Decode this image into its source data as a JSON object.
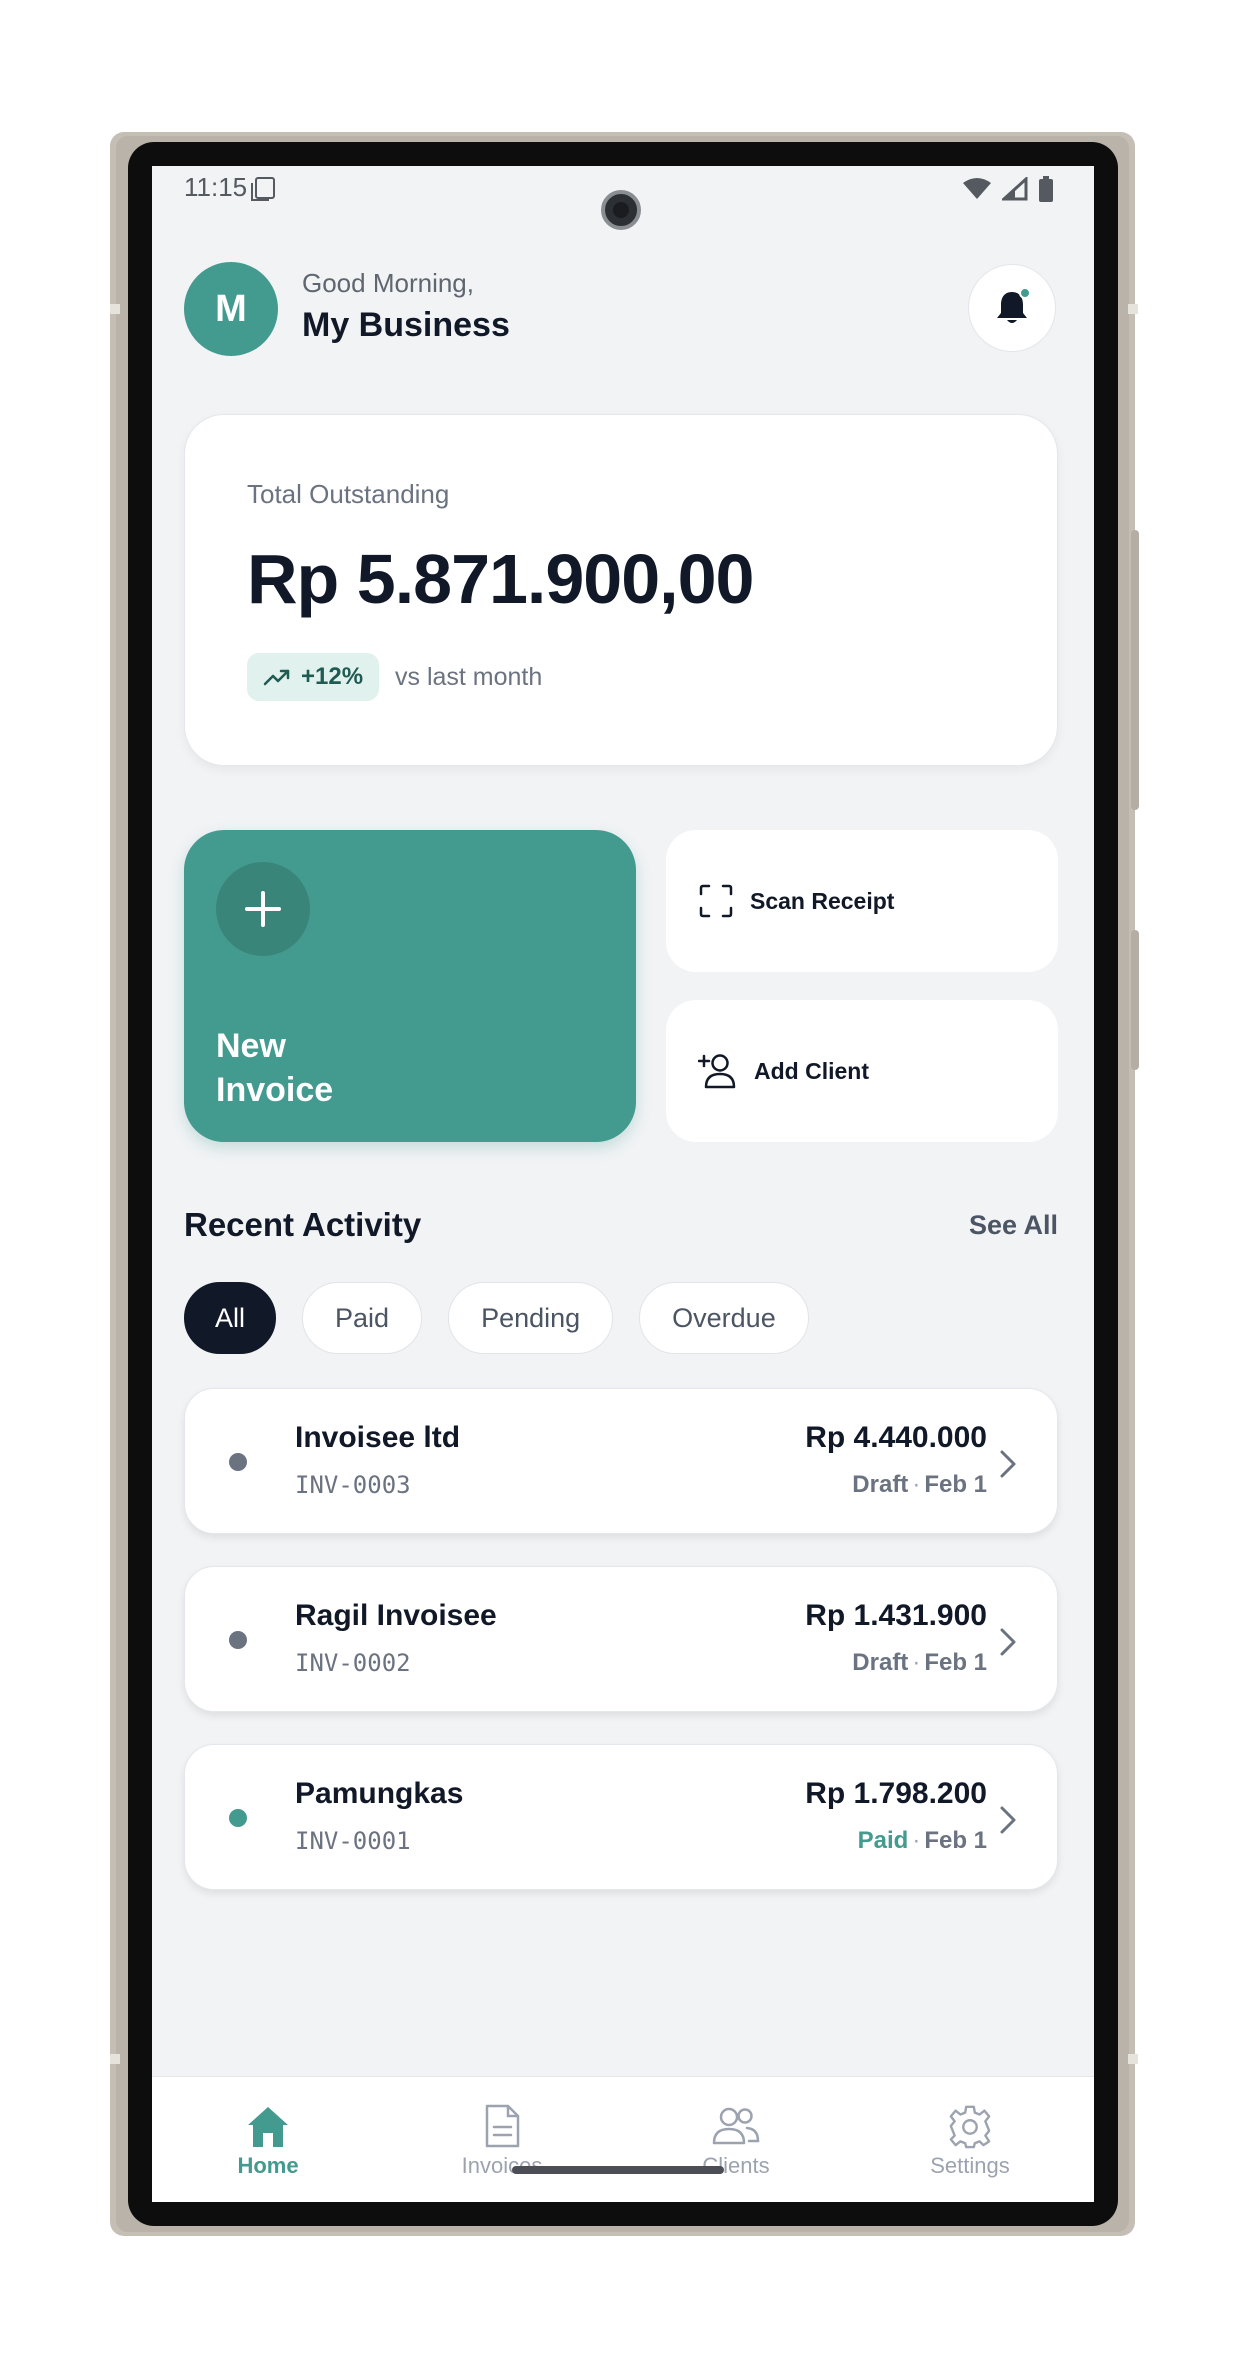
{
  "status_bar": {
    "time": "11:15"
  },
  "header": {
    "avatar_initial": "M",
    "greeting": "Good Morning,",
    "business_name": "My Business"
  },
  "summary": {
    "label": "Total Outstanding",
    "amount": "Rp 5.871.900,00",
    "trend": "+12%",
    "trend_caption": "vs last month"
  },
  "actions": {
    "new_invoice_line1": "New",
    "new_invoice_line2": "Invoice",
    "scan_receipt": "Scan Receipt",
    "add_client": "Add Client"
  },
  "activity": {
    "title": "Recent Activity",
    "see_all": "See All",
    "filters": [
      "All",
      "Paid",
      "Pending",
      "Overdue"
    ],
    "active_filter": "All",
    "items": [
      {
        "name": "Invoisee ltd",
        "id": "INV-0003",
        "amount": "Rp 4.440.000",
        "status": "Draft",
        "date": "Feb 1",
        "status_color": "#6b7280",
        "dot_color": "#6b7280"
      },
      {
        "name": "Ragil Invoisee",
        "id": "INV-0002",
        "amount": "Rp 1.431.900",
        "status": "Draft",
        "date": "Feb 1",
        "status_color": "#6b7280",
        "dot_color": "#6b7280"
      },
      {
        "name": "Pamungkas",
        "id": "INV-0001",
        "amount": "Rp 1.798.200",
        "status": "Paid",
        "date": "Feb 1",
        "status_color": "#439a8e",
        "dot_color": "#439a8e"
      }
    ]
  },
  "nav": {
    "items": [
      {
        "label": "Home",
        "icon": "home-icon",
        "active": true
      },
      {
        "label": "Invoices",
        "icon": "document-icon",
        "active": false
      },
      {
        "label": "Clients",
        "icon": "users-icon",
        "active": false
      },
      {
        "label": "Settings",
        "icon": "gear-icon",
        "active": false
      }
    ]
  },
  "colors": {
    "accent": "#439a8e",
    "dark": "#111827",
    "background": "#f1f3f5"
  }
}
